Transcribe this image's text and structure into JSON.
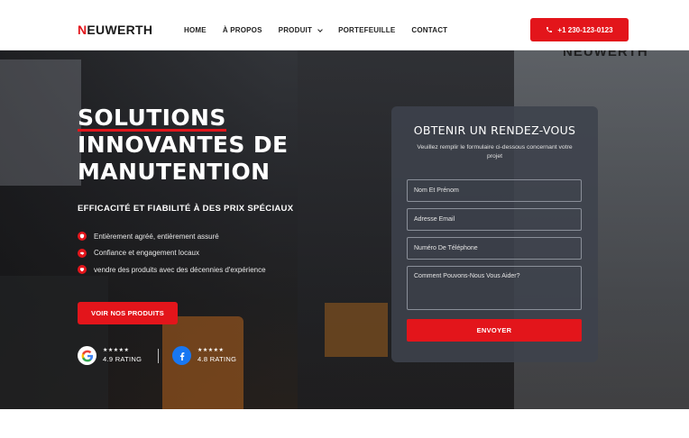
{
  "header": {
    "logo_first_letter": "N",
    "logo_rest": "EUWERTH",
    "nav": [
      {
        "label": "HOME"
      },
      {
        "label": "À PROPOS"
      },
      {
        "label": "PRODUIT"
      },
      {
        "label": "PORTEFEUILLE"
      },
      {
        "label": "CONTACT"
      }
    ],
    "phone": "+1 230-123-0123",
    "phone_icon": "phone-icon"
  },
  "hero": {
    "background_brand_text": "NEUWERTH",
    "title_line1": "SOLUTIONS",
    "title_line2": "INNOVANTES DE",
    "title_line3": "MANUTENTION",
    "tagline": "EFFICACITÉ ET FIABILITÉ À DES PRIX SPÉCIAUX",
    "features": [
      {
        "icon": "shield-icon",
        "text": "Entièrement agréé, entièrement assuré"
      },
      {
        "icon": "handshake-icon",
        "text": "Confiance et engagement locaux"
      },
      {
        "icon": "heart-icon",
        "text": "vendre des produits avec des décennies d'expérience"
      }
    ],
    "cta_label": "VOIR NOS PRODUITS",
    "ratings": [
      {
        "source_icon": "google-icon",
        "stars": "★★★★★",
        "text": "4.9 RATING"
      },
      {
        "source_icon": "facebook-icon",
        "stars": "★★★★★",
        "text": "4.8 RATING"
      }
    ]
  },
  "form": {
    "title": "OBTENIR UN RENDEZ-VOUS",
    "subtitle": "Veuillez remplir le formulaire ci-dessous concernant votre projet",
    "fields": [
      {
        "placeholder": "Nom Et Prénom"
      },
      {
        "placeholder": "Adresse Email"
      },
      {
        "placeholder": "Numéro De Téléphone"
      },
      {
        "placeholder": "Comment Pouvons-Nous Vous Aider?"
      }
    ],
    "submit_label": "ENVOYER"
  },
  "colors": {
    "accent": "#e3151b",
    "form_bg": "#3e424c",
    "facebook": "#1877f2"
  }
}
